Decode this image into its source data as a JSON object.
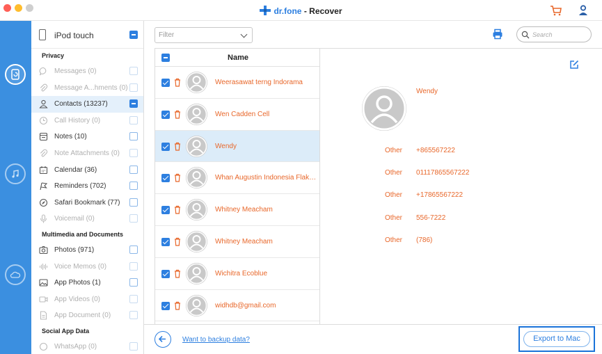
{
  "app": {
    "brand": "dr.fone",
    "separator": " - ",
    "name": "Recover"
  },
  "colors": {
    "accent": "#2d7fe0",
    "rail": "#3b8fe0",
    "contact_text": "#e8672a"
  },
  "device": {
    "name": "iPod touch"
  },
  "sections": {
    "privacy": "Privacy",
    "media": "Multimedia and Documents",
    "social": "Social App Data"
  },
  "categories": {
    "messages": "Messages (0)",
    "message_attachments": "Message A...hments (0)",
    "contacts": "Contacts (13237)",
    "call_history": "Call History (0)",
    "notes": "Notes (10)",
    "note_attachments": "Note Attachments (0)",
    "calendar": "Calendar (36)",
    "reminders": "Reminders (702)",
    "safari": "Safari Bookmark (77)",
    "voicemail": "Voicemail (0)",
    "photos": "Photos (971)",
    "voice_memos": "Voice Memos (0)",
    "app_photos": "App Photos (1)",
    "app_videos": "App Videos (0)",
    "app_document": "App Document (0)",
    "whatsapp": "WhatsApp (0)"
  },
  "toolbar": {
    "filter_placeholder": "Filter",
    "search_placeholder": "Search"
  },
  "list": {
    "header": "Name",
    "contacts": [
      "Weerasawat terng Indorama",
      "Wen Cadden Cell",
      "Wendy",
      "Whan Augustin Indonesia Flakes C...",
      "Whitney Meacham",
      "Whitney Meacham",
      "Wichitra Ecoblue",
      "widhdb@gmail.com"
    ]
  },
  "detail": {
    "name": "Wendy",
    "fields": [
      {
        "label": "Other",
        "value": "+865567222"
      },
      {
        "label": "Other",
        "value": "01117865567222"
      },
      {
        "label": "Other",
        "value": "+17865567222"
      },
      {
        "label": "Other",
        "value": "556-7222"
      },
      {
        "label": "Other",
        "value": "(786)"
      }
    ]
  },
  "footer": {
    "backup_link": "Want to backup data?",
    "export_button": "Export to Mac"
  }
}
